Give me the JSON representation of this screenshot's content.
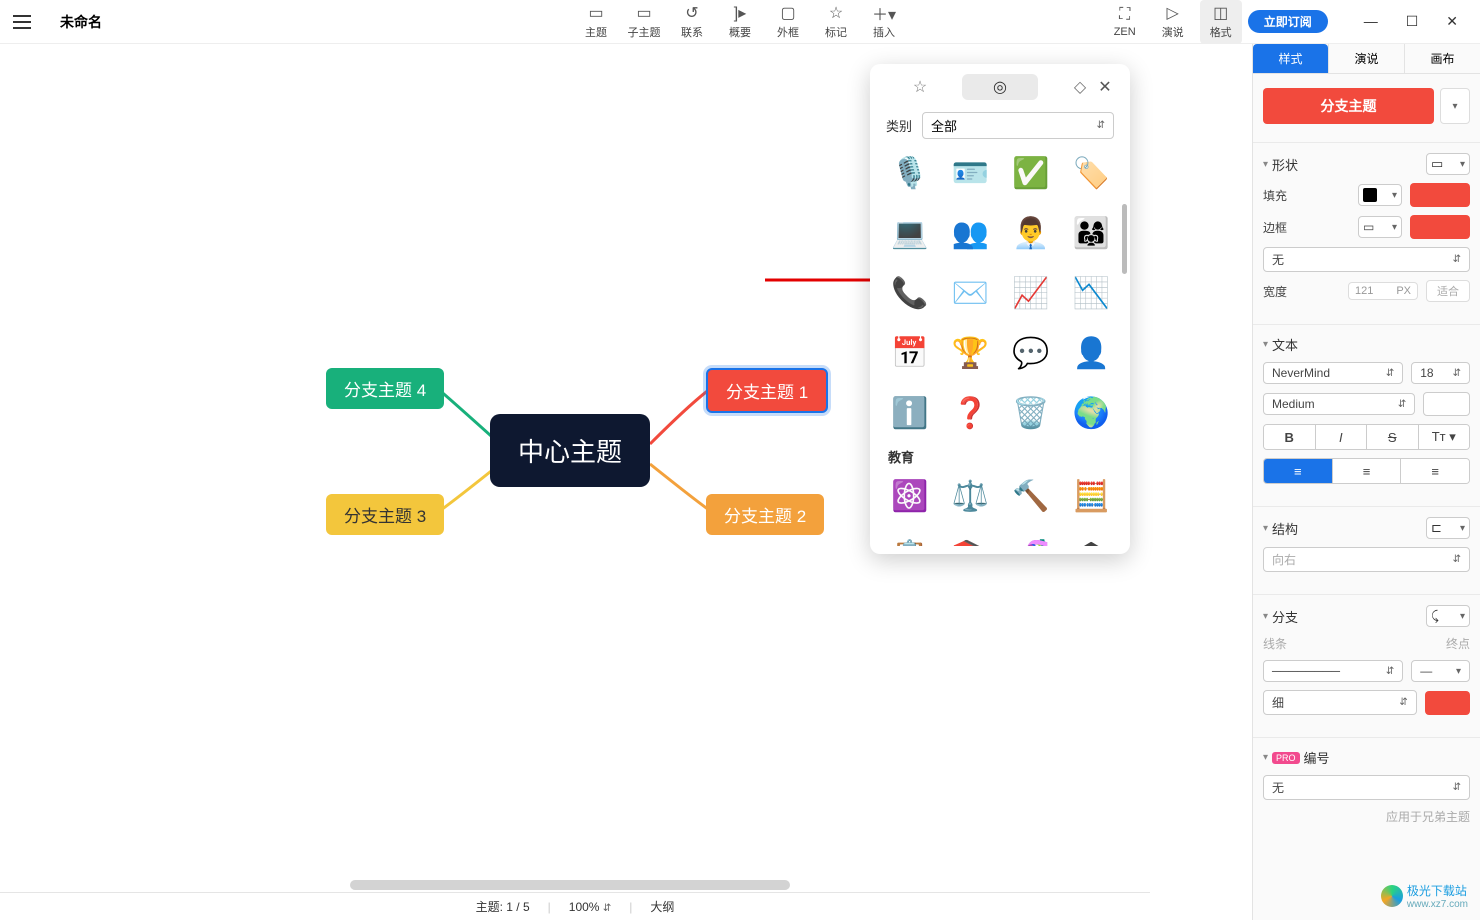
{
  "title": "未命名",
  "toolbar": {
    "items": [
      {
        "label": "主题"
      },
      {
        "label": "子主题"
      },
      {
        "label": "联系"
      },
      {
        "label": "概要"
      },
      {
        "label": "外框"
      },
      {
        "label": "标记"
      },
      {
        "label": "插入"
      }
    ],
    "right": [
      {
        "label": "ZEN"
      },
      {
        "label": "演说"
      },
      {
        "label": "格式"
      }
    ],
    "subscribe": "立即订阅"
  },
  "canvas": {
    "central": "中心主题",
    "branches": [
      "分支主题 1",
      "分支主题 2",
      "分支主题 3",
      "分支主题 4"
    ]
  },
  "sticker_panel": {
    "category_label": "类别",
    "category_value": "全部",
    "section_education": "教育",
    "stickers_common": [
      {
        "name": "microphone-icon",
        "glyph": "🎙️"
      },
      {
        "name": "id-badge-icon",
        "glyph": "🪪"
      },
      {
        "name": "verified-icon",
        "glyph": "✅"
      },
      {
        "name": "stamp-icon",
        "glyph": "🏷️"
      },
      {
        "name": "video-meeting-icon",
        "glyph": "💻"
      },
      {
        "name": "team-chat-icon",
        "glyph": "👥"
      },
      {
        "name": "support-agent-icon",
        "glyph": "👨‍💼"
      },
      {
        "name": "group-icon",
        "glyph": "👨‍👩‍👧"
      },
      {
        "name": "phone-call-icon",
        "glyph": "📞"
      },
      {
        "name": "email-icon",
        "glyph": "✉️"
      },
      {
        "name": "chart-up-icon",
        "glyph": "📈"
      },
      {
        "name": "chart-down-icon",
        "glyph": "📉"
      },
      {
        "name": "calendar-icon",
        "glyph": "📅"
      },
      {
        "name": "ranking-icon",
        "glyph": "🏆"
      },
      {
        "name": "qa-icon",
        "glyph": "💬"
      },
      {
        "name": "user-circle-icon",
        "glyph": "👤"
      },
      {
        "name": "info-icon",
        "glyph": "ℹ️"
      },
      {
        "name": "help-icon",
        "glyph": "❓"
      },
      {
        "name": "trash-icon",
        "glyph": "🗑️"
      },
      {
        "name": "globe-icon",
        "glyph": "🌍"
      }
    ],
    "stickers_education": [
      {
        "name": "atom-icon",
        "glyph": "⚛️"
      },
      {
        "name": "scale-icon",
        "glyph": "⚖️"
      },
      {
        "name": "gavel-icon",
        "glyph": "🔨"
      },
      {
        "name": "abacus-icon",
        "glyph": "🧮"
      },
      {
        "name": "blackboard-icon",
        "glyph": "📋"
      },
      {
        "name": "books-icon",
        "glyph": "📚"
      },
      {
        "name": "dna-icon",
        "glyph": "🧬"
      },
      {
        "name": "graduation-cap-icon",
        "glyph": "🎓"
      }
    ]
  },
  "format_panel": {
    "tabs": [
      "样式",
      "演说",
      "画布"
    ],
    "topic_type": "分支主题",
    "sections": {
      "shape": {
        "title": "形状"
      },
      "fill": {
        "label": "填充",
        "color": "#000000",
        "swatch": "#f24a3d"
      },
      "border": {
        "label": "边框",
        "line": "—",
        "swatch": "#f24a3d"
      },
      "border_style": "无",
      "width": {
        "label": "宽度",
        "value": "121",
        "unit": "PX",
        "fit": "适合"
      },
      "text": {
        "title": "文本",
        "font": "NeverMind",
        "size": "18",
        "weight": "Medium"
      },
      "structure": {
        "title": "结构",
        "direction": "向右"
      },
      "branch": {
        "title": "分支",
        "line_label": "线条",
        "end_label": "终点",
        "thickness": "细",
        "swatch": "#f24a3d"
      },
      "numbering": {
        "title": "编号",
        "pro": "PRO",
        "value": "无"
      },
      "apply_siblings": "应用于兄弟主题"
    }
  },
  "statusbar": {
    "topic_count": "主题: 1 / 5",
    "zoom": "100%",
    "outline": "大纲"
  },
  "watermark": {
    "text": "极光下载站",
    "url": "www.xz7.com"
  }
}
